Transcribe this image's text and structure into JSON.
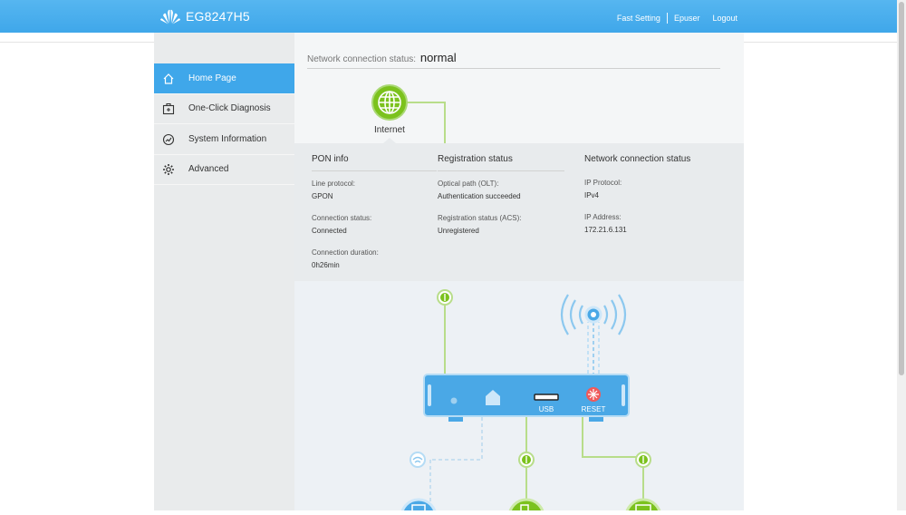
{
  "header": {
    "brand_name": "EG8247H5",
    "links": {
      "fast_setting": "Fast Setting",
      "user": "Epuser",
      "logout": "Logout"
    }
  },
  "sidebar": {
    "items": [
      {
        "label": "Home Page",
        "icon": "home-icon",
        "active": true
      },
      {
        "label": "One-Click Diagnosis",
        "icon": "diagnosis-icon",
        "active": false
      },
      {
        "label": "System Information",
        "icon": "gauge-icon",
        "active": false
      },
      {
        "label": "Advanced",
        "icon": "gear-icon",
        "active": false
      }
    ]
  },
  "main": {
    "status_label": "Network connection status:",
    "status_value": "normal",
    "internet_label": "Internet",
    "pon": {
      "title": "PON info",
      "line_protocol_label": "Line protocol:",
      "line_protocol_value": "GPON",
      "connection_status_label": "Connection status:",
      "connection_status_value": "Connected",
      "connection_duration_label": "Connection duration:",
      "connection_duration_value": "0h26min"
    },
    "registration": {
      "title": "Registration status",
      "optical_label": "Optical path (OLT):",
      "optical_value": "Authentication succeeded",
      "acs_label": "Registration status (ACS):",
      "acs_value": "Unregistered"
    },
    "network": {
      "title": "Network connection status",
      "ip_protocol_label": "IP Protocol:",
      "ip_protocol_value": "IPv4",
      "ip_address_label": "IP Address:",
      "ip_address_value": "172.21.6.131"
    },
    "device": {
      "usb_label": "USB",
      "reset_label": "RESET"
    }
  },
  "colors": {
    "accent": "#3fa7ea",
    "green": "#7bc21d",
    "red": "#f05a5a",
    "device_blue": "#4aa8e6"
  }
}
